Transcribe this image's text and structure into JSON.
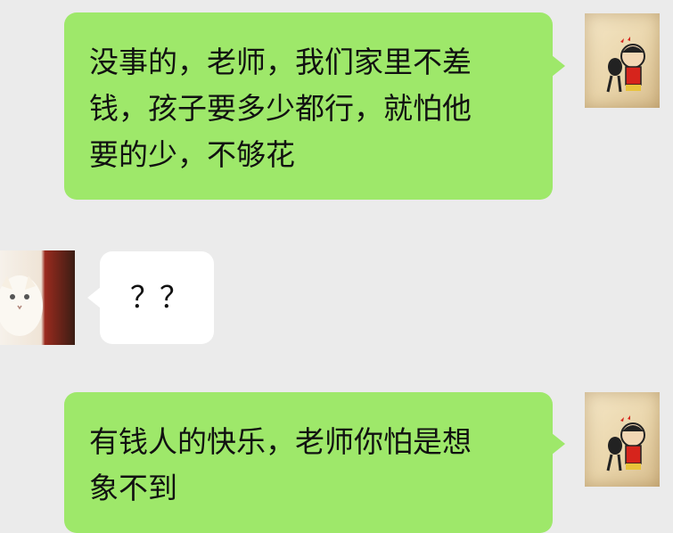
{
  "chat": {
    "messages": [
      {
        "sender": "self",
        "avatar_icon": "cartoon-boy-avatar",
        "text": "没事的，老师，我们家里不差\n钱，孩子要多少都行，就怕他\n要的少，不够花"
      },
      {
        "sender": "other",
        "avatar_icon": "white-cat-avatar",
        "text": "？？"
      },
      {
        "sender": "self",
        "avatar_icon": "cartoon-boy-avatar",
        "text": "有钱人的快乐，老师你怕是想\n象不到"
      }
    ]
  },
  "colors": {
    "background": "#ebebeb",
    "self_bubble": "#9ee86a",
    "other_bubble": "#ffffff",
    "text": "#111111"
  }
}
